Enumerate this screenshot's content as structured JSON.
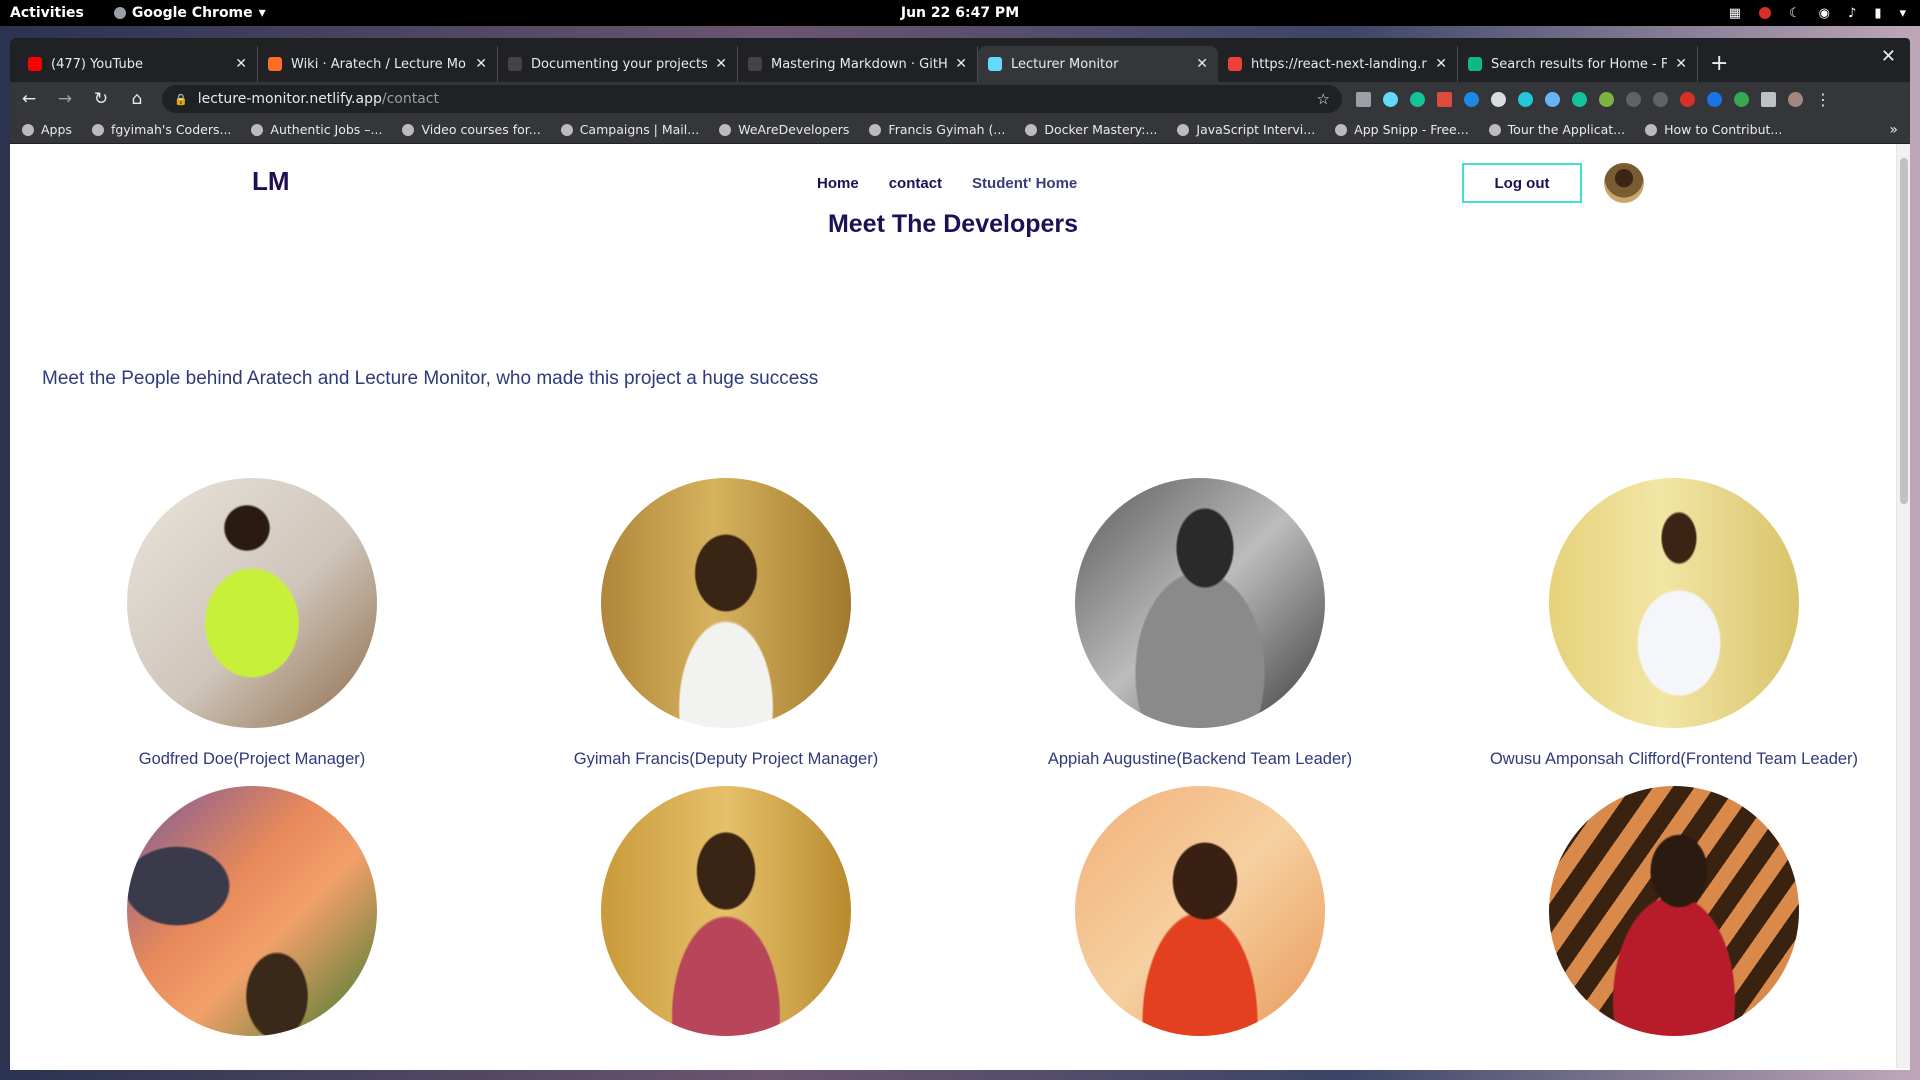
{
  "topbar": {
    "activities": "Activities",
    "app_name": "Google Chrome",
    "clock": "Jun 22  6:47 PM"
  },
  "tabs": [
    {
      "title": "(477) YouTube",
      "color": "#ff0000"
    },
    {
      "title": "Wiki · Aratech / Lecture Monit",
      "color": "#fc6d26"
    },
    {
      "title": "Documenting your projects o",
      "color": "#444444"
    },
    {
      "title": "Mastering Markdown · GitHub",
      "color": "#444444"
    },
    {
      "title": "Lecturer Monitor",
      "color": "#61dafb",
      "active": true
    },
    {
      "title": "https://react-next-landing.re",
      "color": "#ea4335"
    },
    {
      "title": "Search results for Home - Fla",
      "color": "#10b981"
    }
  ],
  "omnibox": {
    "host": "lecture-monitor.netlify.app",
    "path": "/contact"
  },
  "bookmarks": [
    "Apps",
    "fgyimah's Coders...",
    "Authentic Jobs –...",
    "Video courses for...",
    "Campaigns | Mail...",
    "WeAreDevelopers",
    "Francis Gyimah (...",
    "Docker Mastery:...",
    "JavaScript Intervi...",
    "App Snipp - Free...",
    "Tour the Applicat...",
    "How to Contribut..."
  ],
  "site": {
    "logo": "LM",
    "nav": [
      "Home",
      "contact",
      "Student' Home"
    ],
    "logout": "Log out",
    "title": "Meet The Developers",
    "lead": "Meet the People behind Aratech and Lecture Monitor, who made this project a huge success"
  },
  "developers": [
    {
      "caption": "Godfred Doe(Project Manager)"
    },
    {
      "caption": "Gyimah Francis(Deputy Project Manager)"
    },
    {
      "caption": "Appiah Augustine(Backend Team Leader)"
    },
    {
      "caption": "Owusu Amponsah Clifford(Frontend Team Leader)"
    },
    {
      "caption": ""
    },
    {
      "caption": ""
    },
    {
      "caption": ""
    },
    {
      "caption": ""
    }
  ],
  "colors": {
    "brand": "#1f0f55",
    "accent_border": "#40e0d0",
    "text_soft": "#2e3a7a"
  }
}
